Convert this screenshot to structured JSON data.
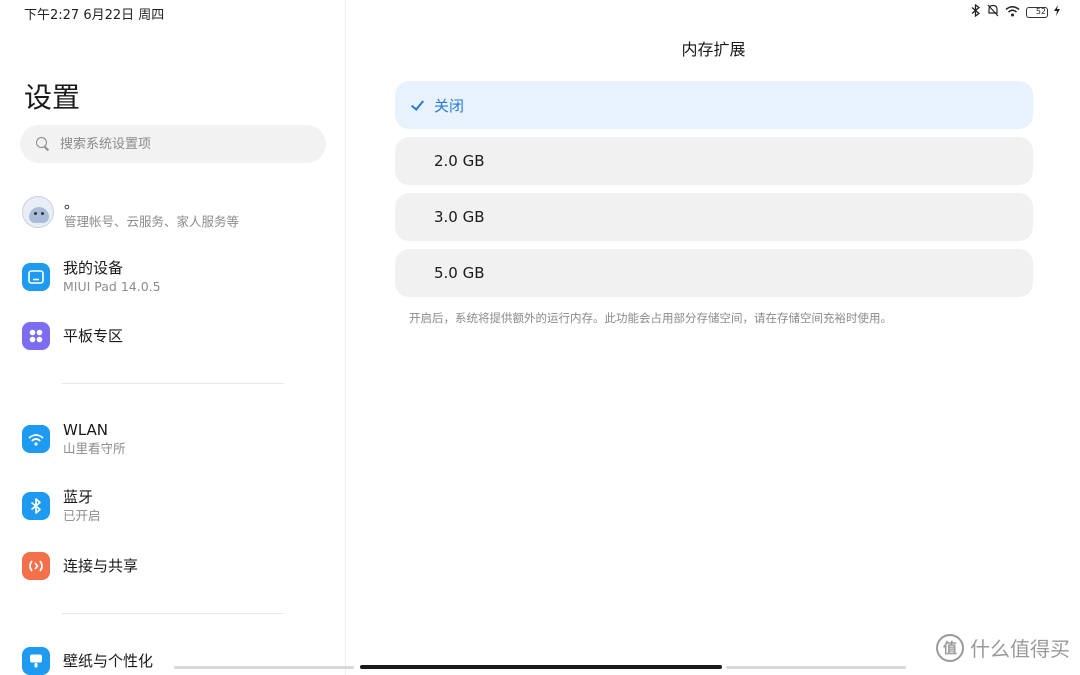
{
  "status_bar": {
    "time": "下午2:27 6月22日 周四",
    "icons": [
      "bluetooth-icon",
      "mute-icon",
      "wifi-icon",
      "battery-icon",
      "charging-icon"
    ],
    "battery_level": "52"
  },
  "sidebar": {
    "title": "设置",
    "search_placeholder": "搜索系统设置项",
    "account": {
      "name": "。",
      "sub": "管理帐号、云服务、家人服务等"
    },
    "items": [
      {
        "label": "我的设备",
        "sub": "MIUI Pad 14.0.5",
        "icon": "device-icon",
        "color": "#1e9bf0"
      },
      {
        "label": "平板专区",
        "sub": "",
        "icon": "apps-icon",
        "color": "#7b6cf0"
      },
      {
        "label": "WLAN",
        "sub": "山里看守所",
        "icon": "wifi-icon",
        "color": "#1e9bf0"
      },
      {
        "label": "蓝牙",
        "sub": "已开启",
        "icon": "bluetooth-icon",
        "color": "#1e9bf0"
      },
      {
        "label": "连接与共享",
        "sub": "",
        "icon": "share-icon",
        "color": "#f2704a"
      },
      {
        "label": "壁纸与个性化",
        "sub": "",
        "icon": "wallpaper-icon",
        "color": "#1e9bf0"
      }
    ]
  },
  "main": {
    "title": "内存扩展",
    "options": [
      {
        "label": "关闭",
        "selected": true
      },
      {
        "label": "2.0 GB",
        "selected": false
      },
      {
        "label": "3.0 GB",
        "selected": false
      },
      {
        "label": "5.0 GB",
        "selected": false
      }
    ],
    "note": "开启后，系统将提供额外的运行内存。此功能会占用部分存储空间，请在存储空间充裕时使用。"
  },
  "watermark": {
    "logo": "值",
    "text": "什么值得买"
  },
  "colors": {
    "accent": "#2a7bd4",
    "selected_bg": "#e8f2fd",
    "option_bg": "#f1f1f1"
  }
}
